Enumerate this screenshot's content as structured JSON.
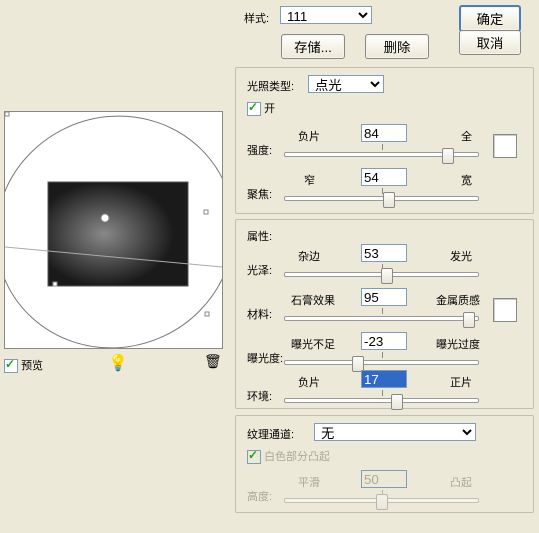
{
  "header": {
    "style_label": "样式:",
    "style_value": "111",
    "save": "存储...",
    "delete": "删除",
    "ok": "确定",
    "cancel": "取消"
  },
  "light": {
    "type_label": "光照类型:",
    "type_value": "点光",
    "on": "开",
    "intensity": {
      "label": "强度:",
      "left": "负片",
      "right": "全",
      "value": "84",
      "pct": 84
    },
    "focus": {
      "label": "聚焦:",
      "left": "窄",
      "right": "宽",
      "value": "54",
      "pct": 54
    }
  },
  "props": {
    "title": "属性:",
    "gloss": {
      "label": "光泽:",
      "left": "杂边",
      "right": "发光",
      "value": "53",
      "pct": 53
    },
    "material": {
      "label": "材料:",
      "left": "石膏效果",
      "right": "金属质感",
      "value": "95",
      "pct": 95
    },
    "exposure": {
      "label": "曝光度:",
      "left": "曝光不足",
      "right": "曝光过度",
      "value": "-23",
      "pct": 38
    },
    "ambience": {
      "label": "环境:",
      "left": "负片",
      "right": "正片",
      "value": "17",
      "pct": 58
    }
  },
  "texture": {
    "channel_label": "纹理通道:",
    "channel_value": "无",
    "white": "白色部分凸起",
    "height": {
      "label": "高度:",
      "left": "平滑",
      "right": "凸起",
      "value": "50",
      "pct": 50
    }
  },
  "preview_label": "预览"
}
